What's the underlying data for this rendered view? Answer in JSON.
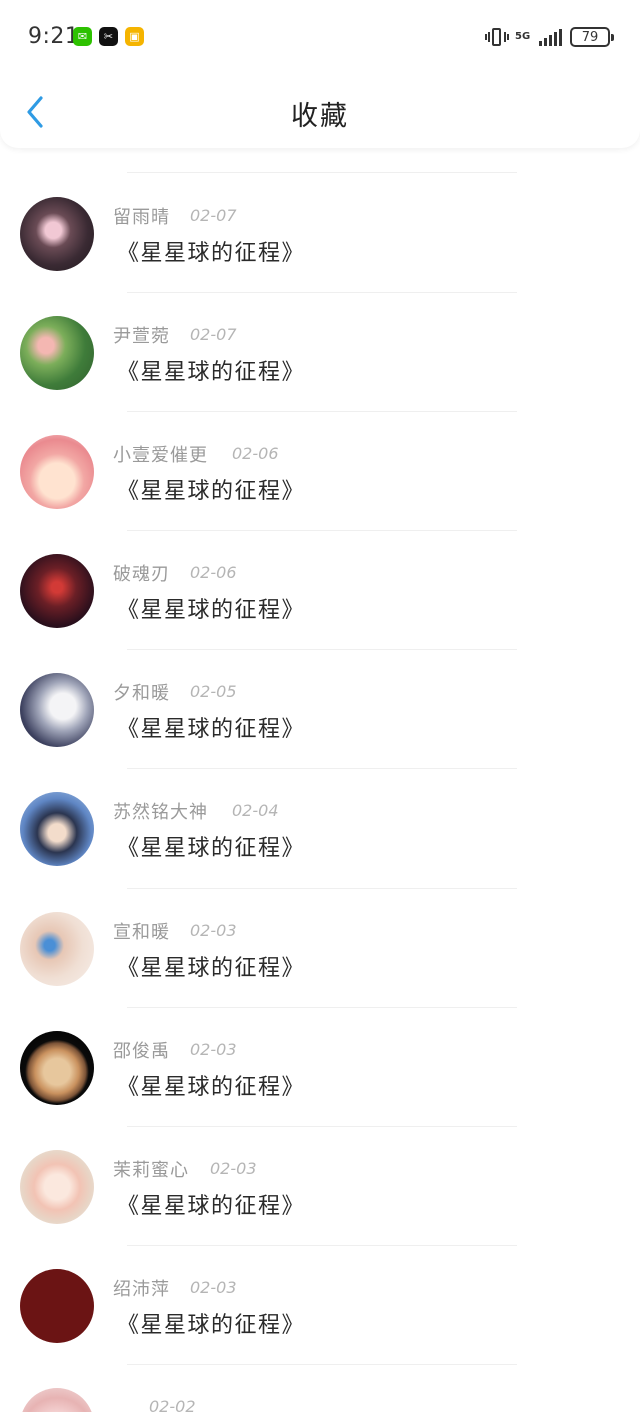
{
  "status_bar": {
    "time": "9:21",
    "apps": [
      {
        "icon": "wechat-icon",
        "color": "#2dc100",
        "glyph": "✉"
      },
      {
        "icon": "capcut-icon",
        "color": "#111111",
        "glyph": "✂"
      },
      {
        "icon": "notes-app-icon",
        "color": "#f5b400",
        "glyph": "▣"
      }
    ],
    "network": "5G",
    "battery": "79"
  },
  "nav": {
    "title": "收藏",
    "back_icon": "chevron-left-icon",
    "accent_color": "#2f9be4"
  },
  "items": [
    {
      "username": "留雨晴",
      "date": "02-07",
      "book": "《星星球的征程》"
    },
    {
      "username": "尹萱菀",
      "date": "02-07",
      "book": "《星星球的征程》"
    },
    {
      "username": "小壹爱催更",
      "date": "02-06",
      "book": "《星星球的征程》"
    },
    {
      "username": "破魂刃",
      "date": "02-06",
      "book": "《星星球的征程》"
    },
    {
      "username": "夕和暖",
      "date": "02-05",
      "book": "《星星球的征程》"
    },
    {
      "username": "苏然铭大神",
      "date": "02-04",
      "book": "《星星球的征程》"
    },
    {
      "username": "宣和暖",
      "date": "02-03",
      "book": "《星星球的征程》"
    },
    {
      "username": "邵俊禹",
      "date": "02-03",
      "book": "《星星球的征程》"
    },
    {
      "username": "茉莉蜜心",
      "date": "02-03",
      "book": "《星星球的征程》"
    },
    {
      "username": "绍沛萍",
      "date": "02-03",
      "book": "《星星球的征程》"
    },
    {
      "username": "",
      "date": "02-02",
      "book": ""
    }
  ]
}
